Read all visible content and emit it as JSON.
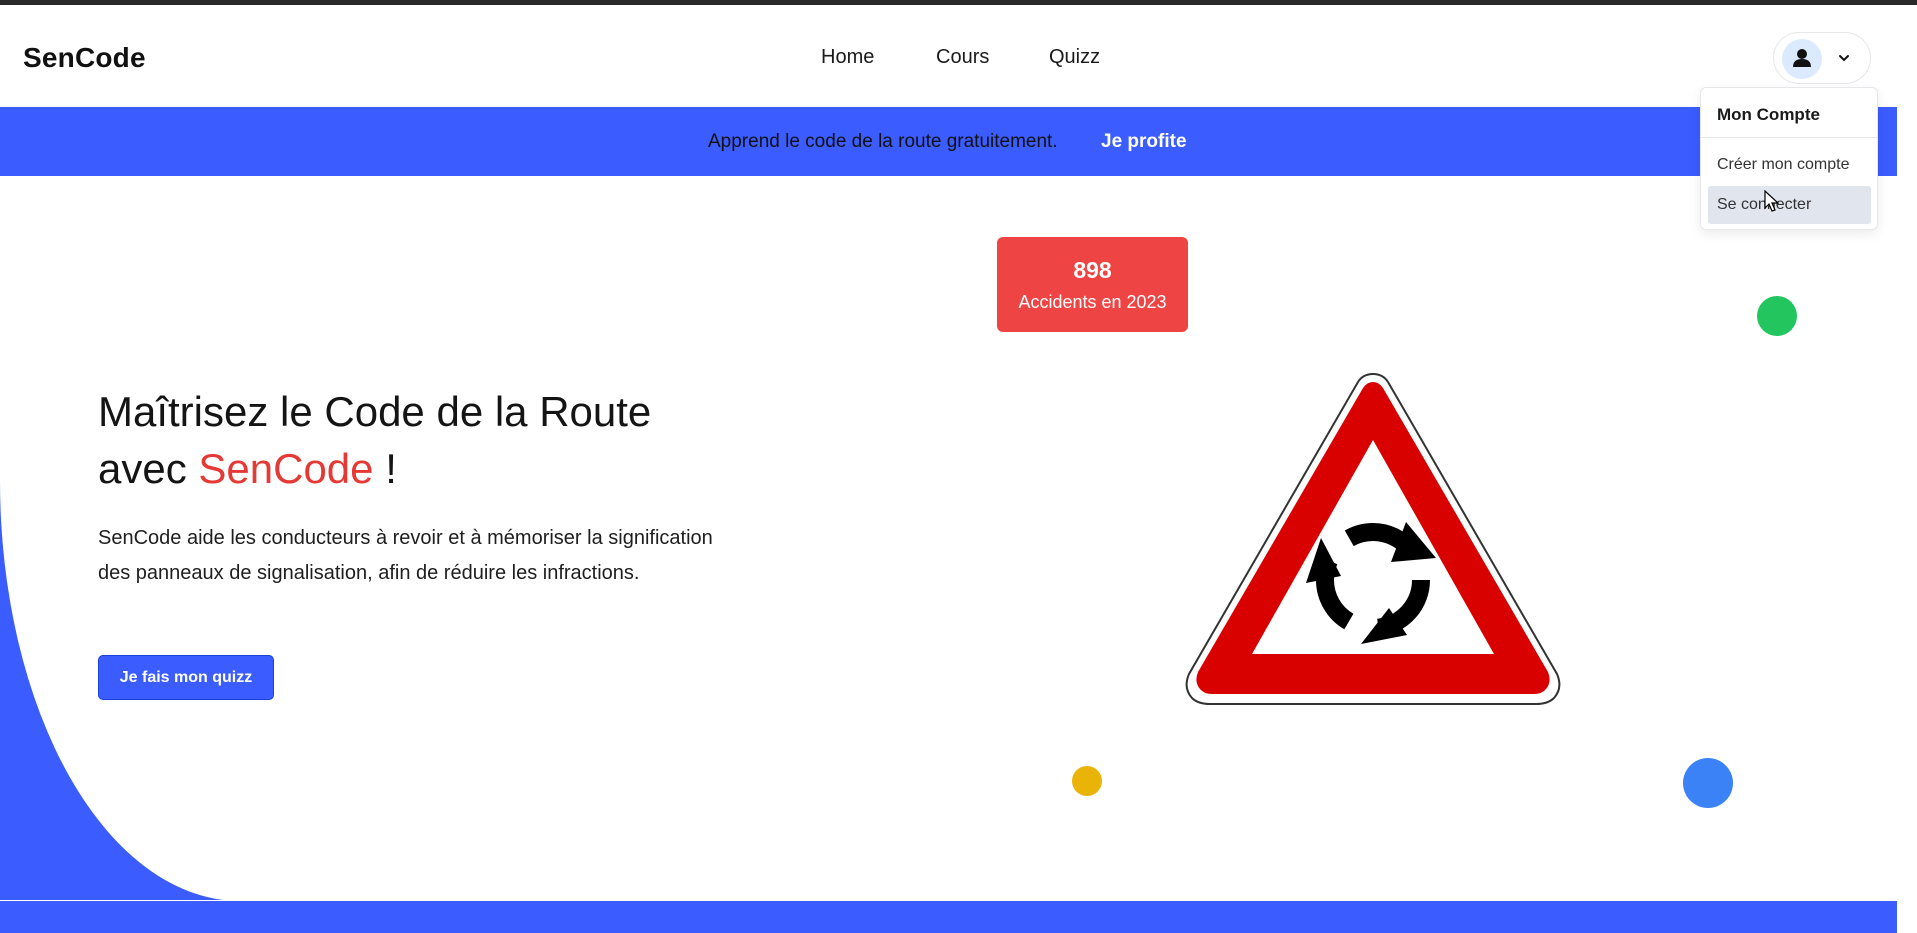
{
  "navbar": {
    "brand": "SenCode",
    "links": [
      "Home",
      "Cours",
      "Quizz"
    ],
    "account_icon": "user-icon",
    "dropdown_icon": "chevron-down-icon"
  },
  "promo": {
    "text": "Apprend le code de la route gratuitement.",
    "link": "Je profite"
  },
  "account_menu": {
    "title": "Mon Compte",
    "items": [
      "Créer mon compte",
      "Se connecter"
    ],
    "hovered_item": "Se connecter"
  },
  "hero": {
    "title_prefix": "Maîtrisez le Code de la Route avec",
    "title_brand": "SenCode",
    "title_suffix": " !",
    "description": "SenCode aide les conducteurs à revoir et à mémoriser la signification des panneaux de signalisation, afin de réduire les infractions.",
    "cta": "Je fais mon quizz"
  },
  "stat": {
    "value": "898",
    "label": "Accidents en 2023"
  },
  "illustration": {
    "sign": "roundabout-warning-sign-icon"
  },
  "colors": {
    "primary": "#3b5cff",
    "accent": "#e53935",
    "stat_bg": "#ef4444",
    "dot_green": "#22c55e",
    "dot_yellow": "#eab308",
    "dot_blue": "#3b82f6"
  }
}
